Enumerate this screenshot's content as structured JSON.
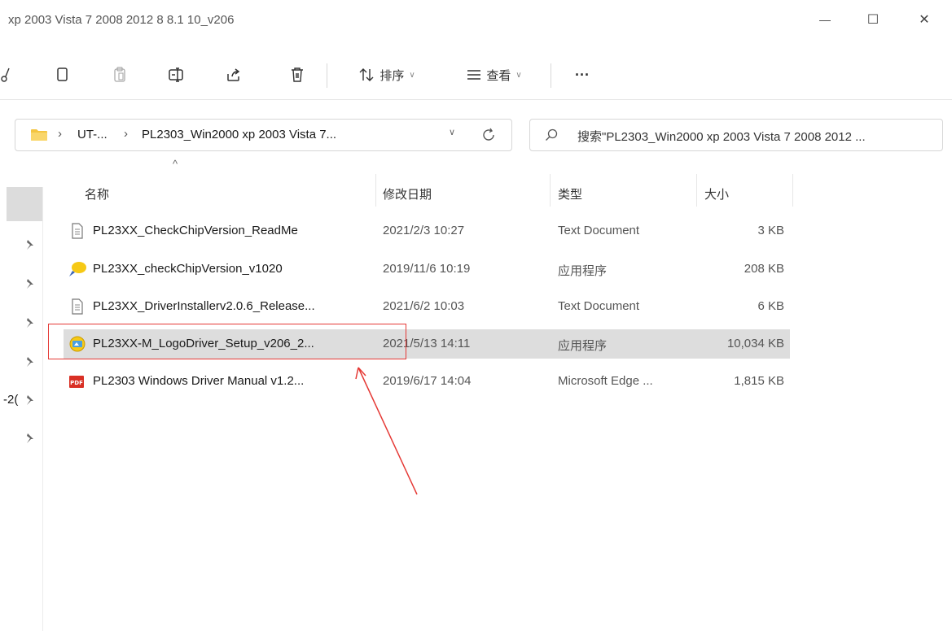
{
  "window": {
    "title": "xp 2003 Vista 7 2008 2012 8 8.1 10_v206",
    "minimize_glyph": "—",
    "maximize_glyph": "☐",
    "close_glyph": "✕"
  },
  "toolbar": {
    "sort_label": "排序",
    "view_label": "查看",
    "more_label": "···"
  },
  "address": {
    "crumb1": "UT-...",
    "crumb2": "PL2303_Win2000 xp 2003 Vista 7...",
    "sep": "›"
  },
  "search": {
    "text": "搜索\"PL2303_Win2000 xp 2003 Vista 7 2008 2012 ..."
  },
  "sidebar": {
    "partial_label": "-2("
  },
  "columns": {
    "name": "名称",
    "date": "修改日期",
    "type": "类型",
    "size": "大小"
  },
  "files": [
    {
      "name": "PL23XX_CheckChipVersion_ReadMe",
      "date": "2021/2/3 10:27",
      "type": "Text Document",
      "size": "3 KB",
      "icon": "text-file-icon"
    },
    {
      "name": "PL23XX_checkChipVersion_v1020",
      "date": "2019/11/6 10:19",
      "type": "应用程序",
      "size": "208 KB",
      "icon": "app-bubble-icon"
    },
    {
      "name": "PL23XX_DriverInstallerv2.0.6_Release...",
      "date": "2021/6/2 10:03",
      "type": "Text Document",
      "size": "6 KB",
      "icon": "text-file-icon"
    },
    {
      "name": "PL23XX-M_LogoDriver_Setup_v206_2...",
      "date": "2021/5/13 14:11",
      "type": "应用程序",
      "size": "10,034 KB",
      "icon": "installer-icon"
    },
    {
      "name": "PL2303 Windows Driver Manual v1.2...",
      "date": "2019/6/17 14:04",
      "type": "Microsoft Edge ...",
      "size": "1,815 KB",
      "icon": "pdf-icon"
    }
  ],
  "colors": {
    "highlight_box": "#e53935",
    "arrow": "#e53935",
    "selected_row": "#dddddd",
    "folder": "#f4c542"
  }
}
